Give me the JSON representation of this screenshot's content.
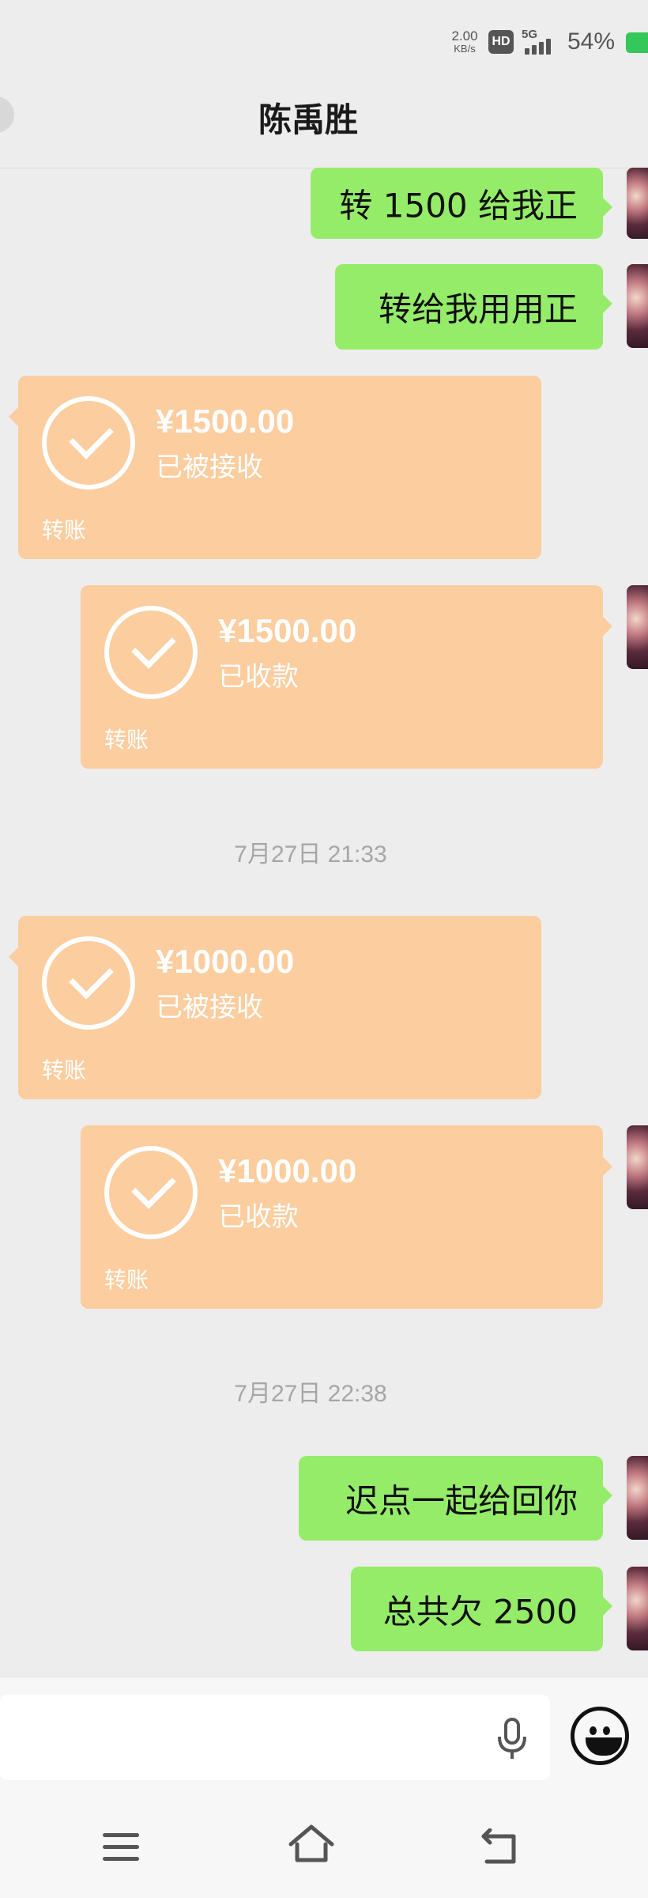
{
  "status_bar": {
    "net_speed_value": "2.00",
    "net_speed_unit": "KB/s",
    "hd_badge": "HD",
    "network": "5G",
    "battery_percent": "54%",
    "battery_color": "#34c759"
  },
  "header": {
    "title": "陈禹胜"
  },
  "messages": {
    "m1": "转 1500 给我正",
    "m2": "转给我用用正",
    "m3": "迟点一起给回你",
    "m4": "总共欠 2500"
  },
  "transfers": {
    "t1": {
      "amount": "¥1500.00",
      "status": "已被接收",
      "label": "转账"
    },
    "t2": {
      "amount": "¥1500.00",
      "status": "已收款",
      "label": "转账"
    },
    "t3": {
      "amount": "¥1000.00",
      "status": "已被接收",
      "label": "转账"
    },
    "t4": {
      "amount": "¥1000.00",
      "status": "已收款",
      "label": "转账"
    }
  },
  "timestamps": {
    "ts1": "7月27日 21:33",
    "ts2": "7月27日 22:38"
  },
  "colors": {
    "chat_background": "#ededed",
    "sent_bubble": "#95ec69",
    "transfer_card": "#fbcd9f"
  },
  "icons": {
    "input_voice": "microphone-icon",
    "emoji": "smiley-icon",
    "nav_menu": "menu-icon",
    "nav_home": "home-icon",
    "nav_back": "back-icon"
  }
}
